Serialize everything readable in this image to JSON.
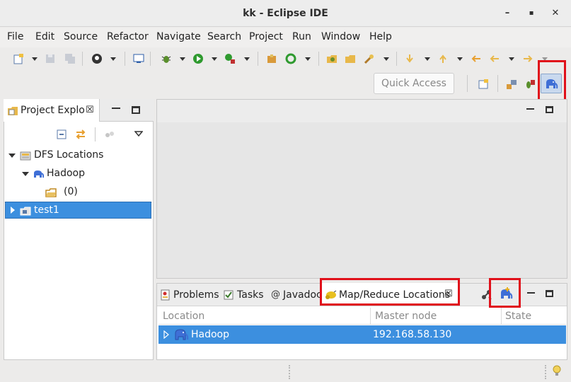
{
  "window": {
    "title": "kk - Eclipse IDE",
    "minimize": "–",
    "maximize": "▪",
    "close": "✕"
  },
  "menu": [
    "File",
    "Edit",
    "Source",
    "Refactor",
    "Navigate",
    "Search",
    "Project",
    "Run",
    "Window",
    "Help"
  ],
  "toolbar": {
    "quick_access_placeholder": "Quick Access"
  },
  "project_explorer": {
    "tab_label": "Project Explo",
    "tree": {
      "dfs_locations": "DFS Locations",
      "hadoop": "Hadoop",
      "folder": "(0)",
      "project": "test1"
    }
  },
  "bottom_panel": {
    "tabs": {
      "problems": "Problems",
      "tasks": "Tasks",
      "javadoc": "Javadoc",
      "mapreduce": "Map/Reduce Locations"
    },
    "columns": [
      "Location",
      "Master node",
      "State"
    ],
    "rows": [
      {
        "location": "Hadoop",
        "master_node": "192.168.58.130",
        "state": ""
      }
    ]
  },
  "colors": {
    "selection": "#3c8fdf",
    "highlight": "#e0101a"
  }
}
